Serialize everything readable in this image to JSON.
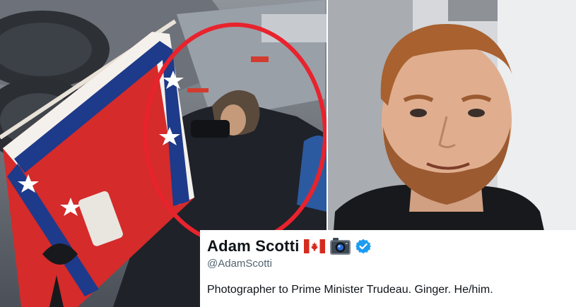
{
  "left_photo": {
    "icons": [
      "confederate-flag-icon",
      "red-circle-highlight"
    ]
  },
  "right_photo": {},
  "profile_card": {
    "name": "Adam Scotti",
    "handle": "@AdamScotti",
    "bio": "Photographer to Prime Minister Trudeau. Ginger. He/him.",
    "icons": [
      "canada-flag-icon",
      "camera-icon",
      "verified-icon"
    ],
    "accent_color": "#1d9bf0"
  }
}
